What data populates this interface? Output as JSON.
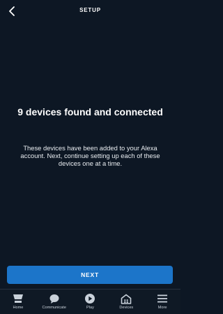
{
  "header": {
    "title": "SETUP",
    "back_icon": "chevron-left-icon"
  },
  "main": {
    "headline": "9 devices found and connected",
    "message": "These devices have been added to your Alexa account. Next, continue setting up each of these devices one at a time."
  },
  "actions": {
    "next_label": "NEXT"
  },
  "bottom_nav": {
    "items": [
      {
        "label": "Home",
        "icon": "home-icon"
      },
      {
        "label": "Communicate",
        "icon": "chat-bubble-icon"
      },
      {
        "label": "Play",
        "icon": "play-icon"
      },
      {
        "label": "Devices",
        "icon": "devices-icon"
      },
      {
        "label": "More",
        "icon": "menu-icon"
      }
    ]
  },
  "colors": {
    "background": "#0d1724",
    "accent": "#1c75c9",
    "text": "#ffffff",
    "nav_label": "#c9d1da"
  }
}
